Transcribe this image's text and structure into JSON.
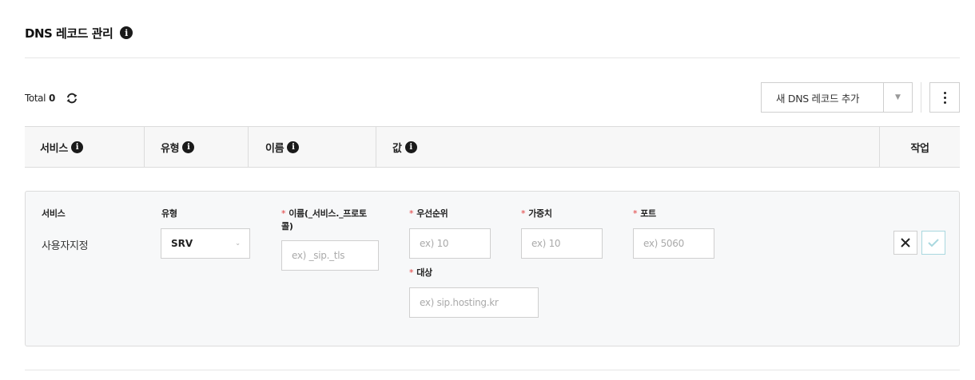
{
  "header": {
    "title": "DNS 레코드 관리",
    "info_icon_glyph": "i"
  },
  "toolbar": {
    "total_label": "Total",
    "total_count": "0",
    "add_record_select": "새 DNS 레코드 추가",
    "more_icon": "more-vertical-icon"
  },
  "table": {
    "headers": {
      "service": "서비스",
      "type": "유형",
      "name": "이름",
      "value": "값",
      "action": "작업"
    }
  },
  "form": {
    "service_label": "서비스",
    "service_value": "사용자지정",
    "type_label": "유형",
    "type_value": "SRV",
    "name_label": "이름(_서비스._프로토콜)",
    "name_placeholder": "ex) _sip._tls",
    "priority_label": "우선순위",
    "priority_placeholder": "ex) 10",
    "weight_label": "가중치",
    "weight_placeholder": "ex) 10",
    "port_label": "포트",
    "port_placeholder": "ex) 5060",
    "target_label": "대상",
    "target_placeholder": "ex) sip.hosting.kr",
    "required_mark": "*"
  },
  "colors": {
    "accent_check": "#a9d8df",
    "required": "#e03b3b"
  }
}
